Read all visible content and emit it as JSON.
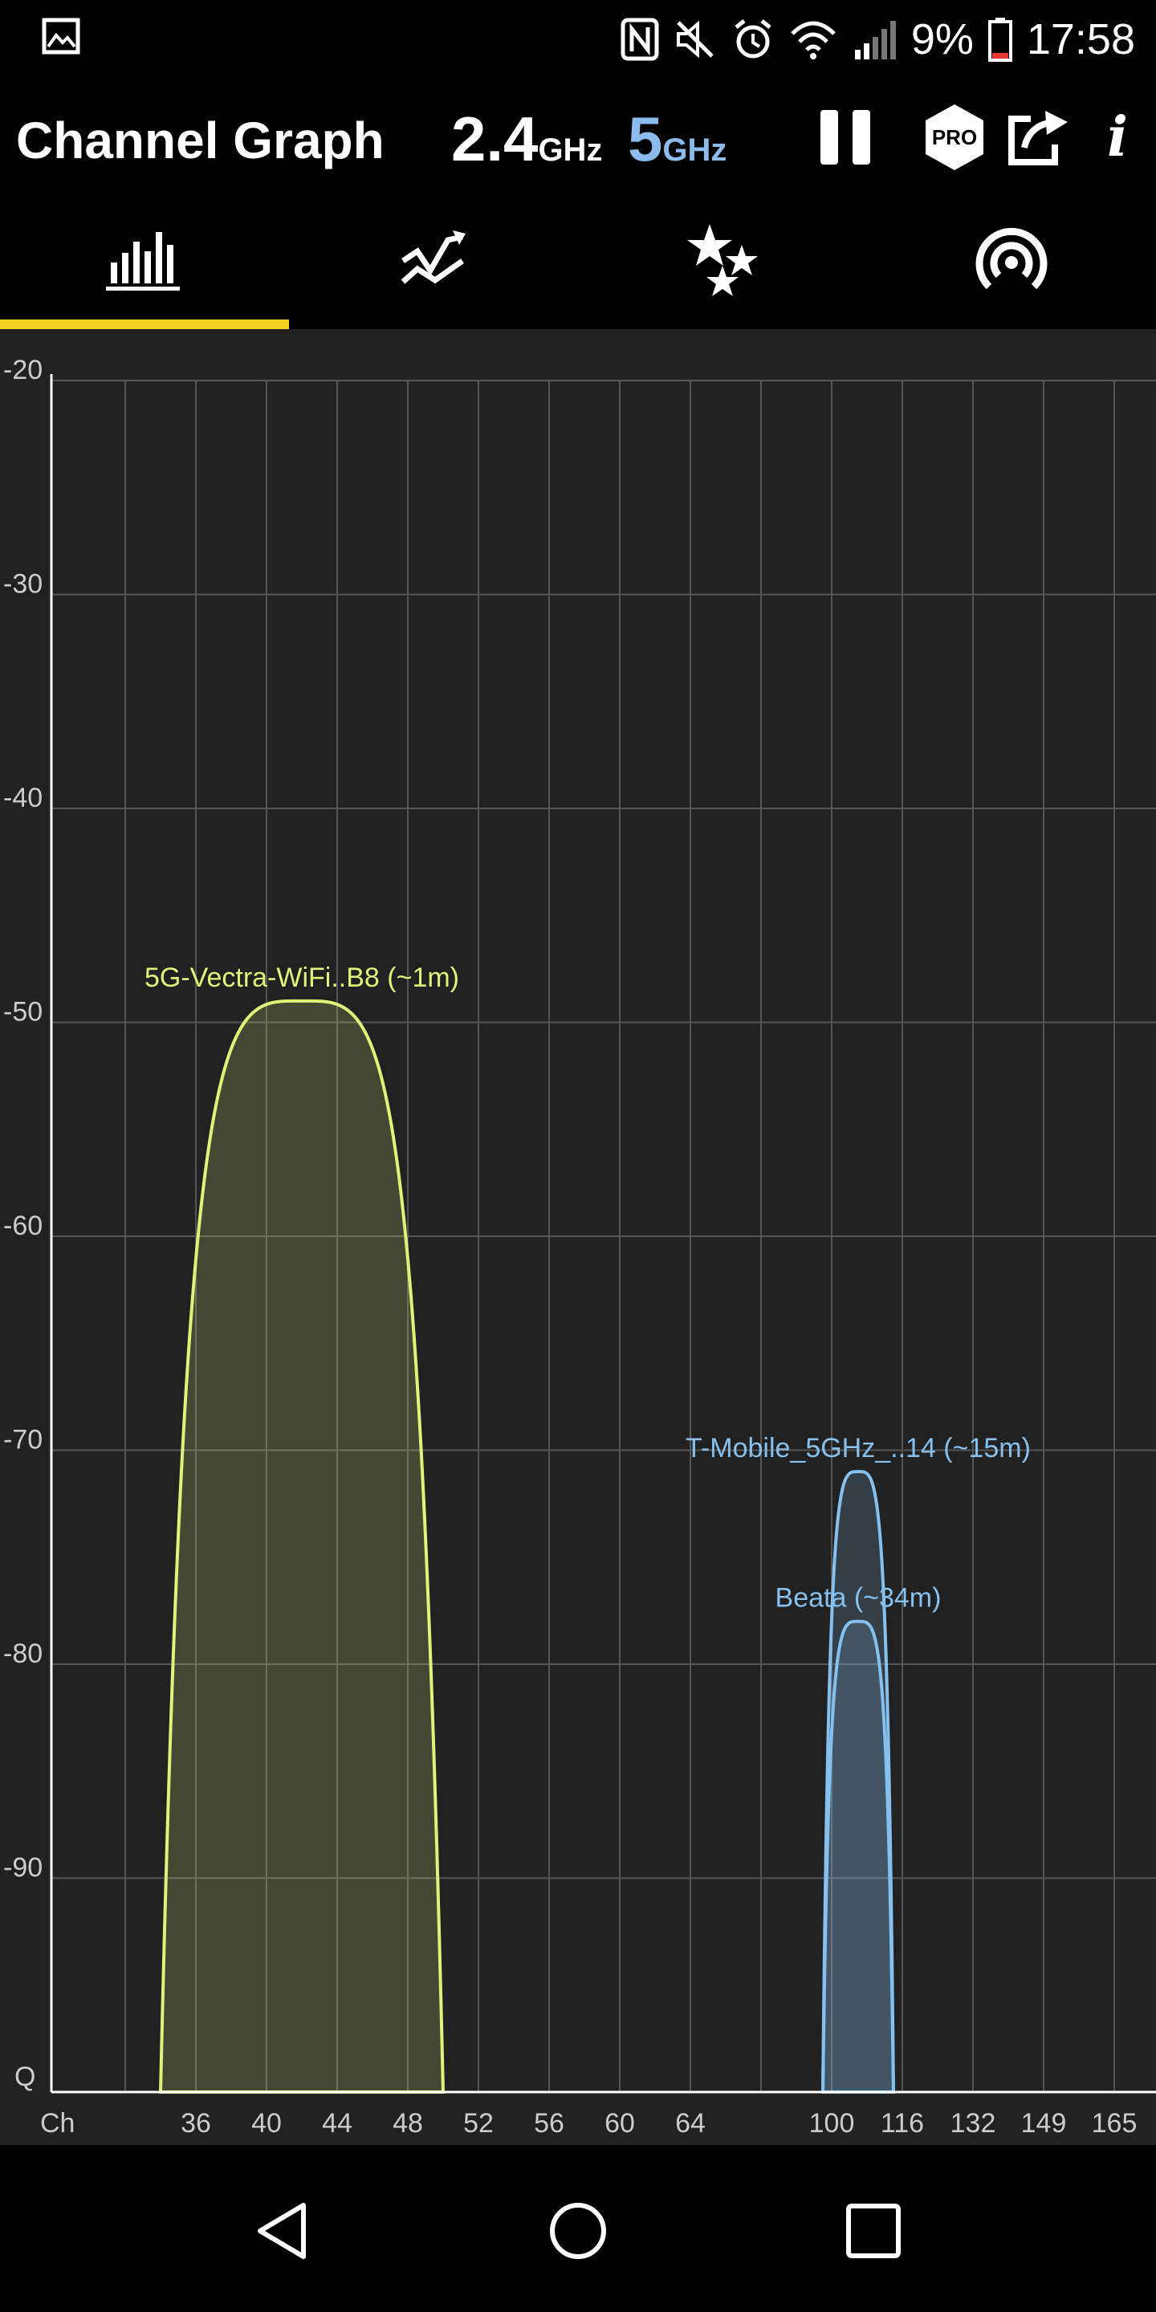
{
  "status_bar": {
    "battery": "9%",
    "time": "17:58",
    "icons": [
      "gallery-icon",
      "nfc-icon",
      "mute-icon",
      "alarm-icon",
      "wifi-icon",
      "cell-signal-icon",
      "battery-icon"
    ]
  },
  "app_bar": {
    "title": "Channel Graph",
    "band_24_number": "2.4",
    "band_24_unit": "GHz",
    "band_5_number": "5",
    "band_5_unit": "GHz",
    "icons": [
      "pause-icon",
      "pro-badge-icon",
      "share-icon",
      "info-icon"
    ],
    "pro_label": "PRO",
    "info_label": "i"
  },
  "tabs": {
    "items": [
      "bar-chart-icon",
      "time-graph-icon",
      "stars-icon",
      "access-point-icon"
    ],
    "active_index": 0
  },
  "colors": {
    "accent": "#f5d320",
    "band_5": "#8cbcee",
    "series_vectra": "#e1f27a",
    "series_other": "#86c0ee",
    "grid": "#555555",
    "background": "#212121"
  },
  "chart_data": {
    "type": "area",
    "ylim": [
      -100,
      -20
    ],
    "y_ticks": [
      "-20",
      "-30",
      "-40",
      "-50",
      "-60",
      "-70",
      "-80",
      "-90"
    ],
    "y_bottom_label": "Q",
    "x_axis_label": "Ch",
    "x_ticks": [
      "36",
      "40",
      "44",
      "48",
      "52",
      "56",
      "60",
      "64",
      "100",
      "116",
      "132",
      "149",
      "165"
    ],
    "series": [
      {
        "name": "5G-Vectra-WiFi..B8 (~1m)",
        "center_channel": 42,
        "width_mhz": 80,
        "peak_dbm": -49,
        "color": "#e1f27a"
      },
      {
        "name": "T-Mobile_5GHz_..14 (~15m)",
        "center_channel": 106,
        "width_mhz": 40,
        "peak_dbm": -71,
        "color": "#86c0ee"
      },
      {
        "name": "Beata (~34m)",
        "center_channel": 106,
        "width_mhz": 40,
        "peak_dbm": -78,
        "color": "#86c0ee"
      }
    ]
  },
  "nav_bar": {
    "buttons": [
      "back-icon",
      "home-icon",
      "recents-icon"
    ]
  }
}
